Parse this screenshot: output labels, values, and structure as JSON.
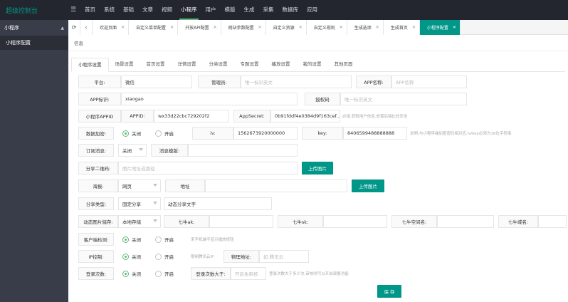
{
  "app": {
    "logo": "超级控制台"
  },
  "topnav": [
    {
      "label": "首页"
    },
    {
      "label": "系统"
    },
    {
      "label": "基础"
    },
    {
      "label": "文章"
    },
    {
      "label": "视频"
    },
    {
      "label": "小程序"
    },
    {
      "label": "用户"
    },
    {
      "label": "模版"
    },
    {
      "label": "生成"
    },
    {
      "label": "采集"
    },
    {
      "label": "数据库"
    },
    {
      "label": "应用"
    }
  ],
  "sidebar": {
    "group": "小程序",
    "item": "小程序配置"
  },
  "tabs": [
    {
      "label": "欢迎页面"
    },
    {
      "label": "自定义菜单配置"
    },
    {
      "label": "开放API配置"
    },
    {
      "label": "网站参数配置"
    },
    {
      "label": "自定义资源"
    },
    {
      "label": "自定义规则"
    },
    {
      "label": "生成选项"
    },
    {
      "label": "生成首页"
    },
    {
      "label": "小程序配置"
    }
  ],
  "breadcrumb": "信息",
  "subtabs": [
    {
      "label": "小程序设置"
    },
    {
      "label": "场景设置"
    },
    {
      "label": "首页设置"
    },
    {
      "label": "详情设置"
    },
    {
      "label": "分类设置"
    },
    {
      "label": "专题设置"
    },
    {
      "label": "播放设置"
    },
    {
      "label": "我的设置"
    },
    {
      "label": "其他页面"
    }
  ],
  "form": {
    "platform_label": "平台:",
    "platform_value": "微信",
    "admin_label": "管理员:",
    "admin_placeholder": "唯一标识英文",
    "appname_label": "APP名称:",
    "appname_placeholder": "APP名称",
    "appid_ident_label": "APP标识:",
    "appid_ident_value": "xiaogao",
    "auth_label": "授权码",
    "auth_placeholder": "唯一标识英文",
    "mini_appid_label": "小程序APPID",
    "appid_label": "APPID:",
    "appid_value": "wx33d22cbc729202f2",
    "appsecret_label": "AppSecret:",
    "appsecret_value": "0b91fddf4e0384d9f163cef..",
    "appsecret_tip": "必填,获取用户信息,放置后端比较安全",
    "encrypt_label": "数据加密:",
    "off": "关闭",
    "on": "开启",
    "iv_label": "iv:",
    "iv_value": "1562673920000000",
    "key_label": "key:",
    "key_value": "8406599488888888",
    "encrypt_tip": "说明:与小程序端加密密码相对应,iv/key必须为16位字符串",
    "subscribe_label": "订阅消息:",
    "subscribe_value": "关闭",
    "template_label": "消息模版:",
    "qrcode_label": "分享二维码:",
    "qrcode_placeholder": "图片地址或路径",
    "upload_label": "上传图片",
    "poster_label": "海报:",
    "poster_value": "网页",
    "address_label": "地址",
    "share_type_label": "分享类型:",
    "share_type_value": "固定分享",
    "share_text_label": "动态分享文字",
    "storage_label": "动态图片储存:",
    "storage_value": "本地存储",
    "qiniu_ak_label": "七牛ak:",
    "qiniu_sk_label": "七牛sk:",
    "qiniu_space_label": "七牛空间名:",
    "qiniu_domain_label": "七牛域名:",
    "client_detect_label": "客户端检测:",
    "client_detect_tip": "来手机端不显示播放按钮",
    "ip_label": "IP控制:",
    "ip_tip": "限制腾讯云IP",
    "physical_label": "物理地址:",
    "physical_placeholder": "如:腾讯云",
    "login_label": "登录次数:",
    "login_over_label": "登录次数大于:",
    "login_over_placeholder": "开启免审核",
    "login_tip": "登录次数大于多少次,审核时可以开启观看功能",
    "save_label": "保 存"
  },
  "colors": {
    "accent": "#009688",
    "radio_on": "#5fb878",
    "topbar": "#23262e",
    "sidebar": "#393d49"
  }
}
